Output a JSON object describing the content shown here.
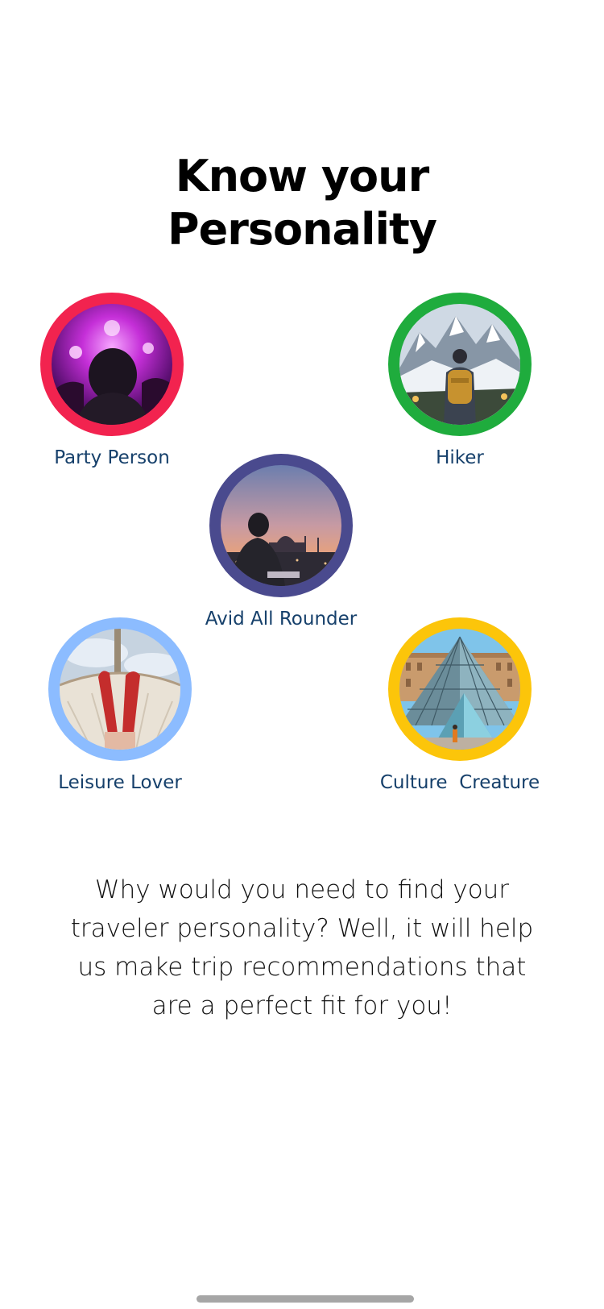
{
  "title": {
    "line1": "Know your",
    "line2": "Personality"
  },
  "personas": [
    {
      "id": "party",
      "label": "Party Person",
      "ring_color": "#f2234f",
      "photo_icon": "concert-crowd-icon"
    },
    {
      "id": "hiker",
      "label": "Hiker",
      "ring_color": "#1fac3d",
      "photo_icon": "mountain-hiker-icon"
    },
    {
      "id": "allrounder",
      "label": "Avid All Rounder",
      "ring_color": "#4a4a8e",
      "photo_icon": "city-sunset-icon"
    },
    {
      "id": "leisure",
      "label": "Leisure Lover",
      "ring_color": "#8cbcff",
      "photo_icon": "hammock-feet-icon"
    },
    {
      "id": "culture",
      "label": "Culture  Creature",
      "ring_color": "#fcc50a",
      "photo_icon": "louvre-pyramid-icon"
    }
  ],
  "description": "Why would you need to find your traveler personality? Well, it will help us make trip recommendations that are a perfect fit for you!"
}
